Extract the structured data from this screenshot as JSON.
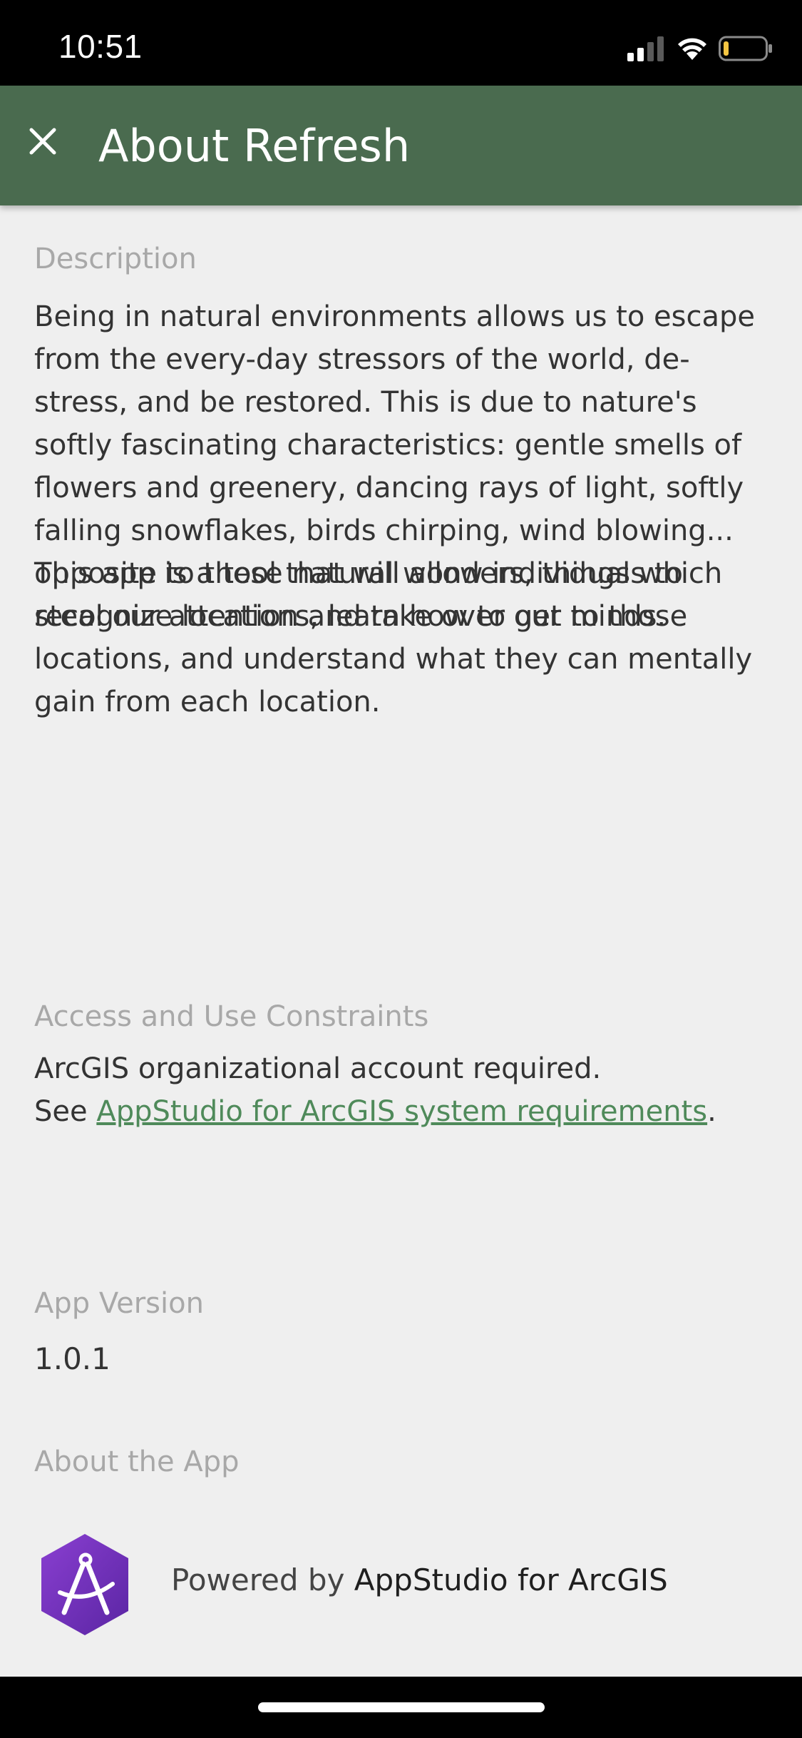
{
  "status_bar": {
    "time": "10:51",
    "signal_icon": "cellular-signal-icon",
    "wifi_icon": "wifi-icon",
    "battery_icon": "battery-low-icon",
    "battery_color": "#f5c542"
  },
  "app_bar": {
    "close_icon": "close-icon",
    "title": "About Refresh",
    "background": "#4a6b4f"
  },
  "description": {
    "label": "Description",
    "paragraph_1": "Being in natural environments allows us to escape from the every-day stressors of the world, de-stress, and be restored. This is due to nature's softly fascinating characteristics: gentle smells of flowers and greenery, dancing rays of light, softly falling snowflakes, birds chirping, wind blowing... opposite to these natural wonders, things which steal our attention and take over our minds.",
    "paragraph_2": "This app is a tool that will allow individuals to recognize locations, learn how to get to those locations, and understand what they can mentally gain from each location."
  },
  "constraints": {
    "label": "Access and Use Constraints",
    "line_1": "ArcGIS organizational account required.",
    "see_prefix": "See ",
    "link_text": "AppStudio for ArcGIS system requirements",
    "suffix": ".",
    "link_color": "#4f8a5a"
  },
  "app_version": {
    "label": "App Version",
    "value": "1.0.1"
  },
  "about_app": {
    "label": "About the App",
    "logo_icon": "appstudio-logo-icon",
    "logo_color": "#6a2fb5",
    "powered_prefix": "Powered by ",
    "powered_name": "AppStudio for ArcGIS"
  }
}
